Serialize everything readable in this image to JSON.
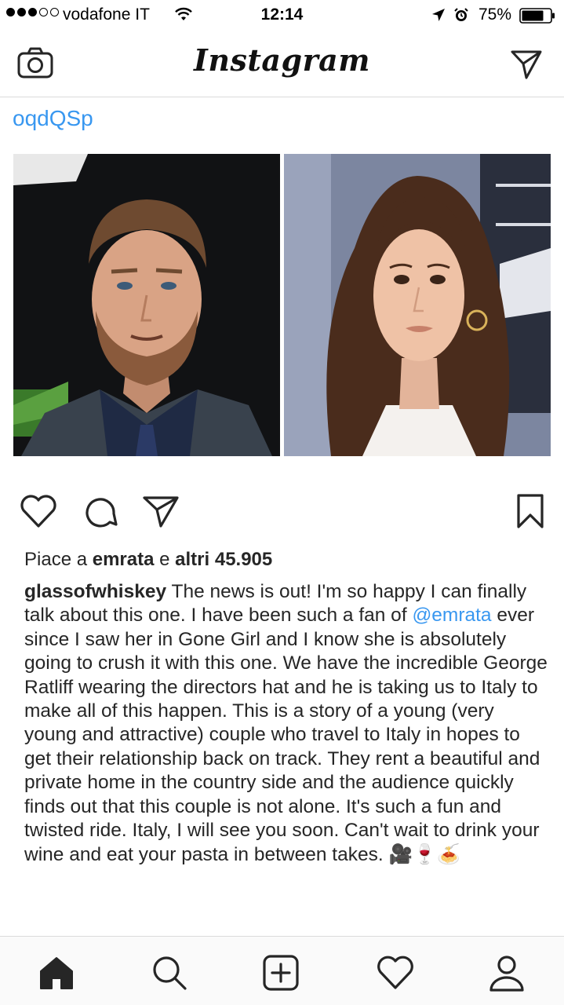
{
  "status_bar": {
    "carrier": "vodafone IT",
    "time": "12:14",
    "battery": "75%"
  },
  "nav": {
    "title": "Instagram"
  },
  "post": {
    "username": "oqdQSp",
    "likes_prefix": "Piace a",
    "likes_user": "emrata",
    "likes_joiner": "e",
    "likes_others": "altri 45.905",
    "caption_author": "glassofwhiskey",
    "caption_part1": "The news is out! I'm so happy I can finally talk about this one. I have been such a fan of",
    "caption_mention": "@emrata",
    "caption_part2": "ever since I saw her in Gone Girl and I know she is absolutely going to crush it with this one. We have the incredible George Ratliff wearing the directors hat and he is taking us to Italy to make all of this happen. This is a story of a young (very young and attractive) couple who travel to Italy in hopes to get their relationship back on track. They rent a beautiful and private home in the country side and the audience quickly finds out that this couple is not alone. It's such a fun and twisted ride. Italy, I will see you soon. Can't wait to drink your wine and eat your pasta in between takes.",
    "caption_emojis": "🎥🍷🍝"
  },
  "tabs": [
    "home",
    "search",
    "add",
    "activity",
    "profile"
  ],
  "colors": {
    "link_blue": "#3897f0",
    "text": "#262626",
    "divider": "#dbdbdb"
  }
}
